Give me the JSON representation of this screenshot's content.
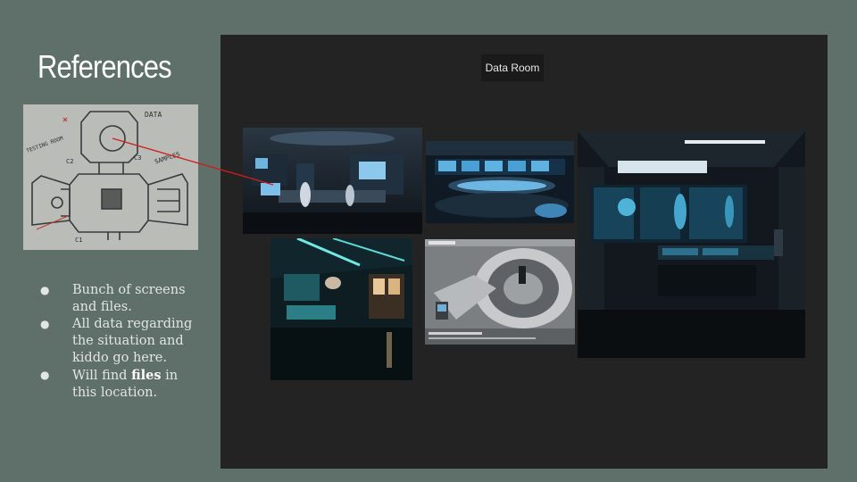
{
  "slide": {
    "title": "References",
    "room_label": "Data Room",
    "bullets": [
      {
        "text": "Bunch of screens and files."
      },
      {
        "text": "All data regarding the situation and kiddo go here."
      },
      {
        "pre": "Will find ",
        "bold": "files",
        "post": " in this location."
      }
    ],
    "sketch_labels": {
      "data": "DATA",
      "testing": "TESTING ROOM",
      "samples": "SAMPLES",
      "c1": "C1",
      "c2": "C2",
      "c3": "C3"
    }
  },
  "colors": {
    "background": "#5f6f6a",
    "panel": "#232323",
    "connector_line": "#d11d1d"
  },
  "images": [
    {
      "name": "lab-screens-photo"
    },
    {
      "name": "control-room-photo"
    },
    {
      "name": "futuristic-monitor-room-photo"
    },
    {
      "name": "teal-lit-room-photo"
    },
    {
      "name": "floorplan-render-photo"
    }
  ]
}
